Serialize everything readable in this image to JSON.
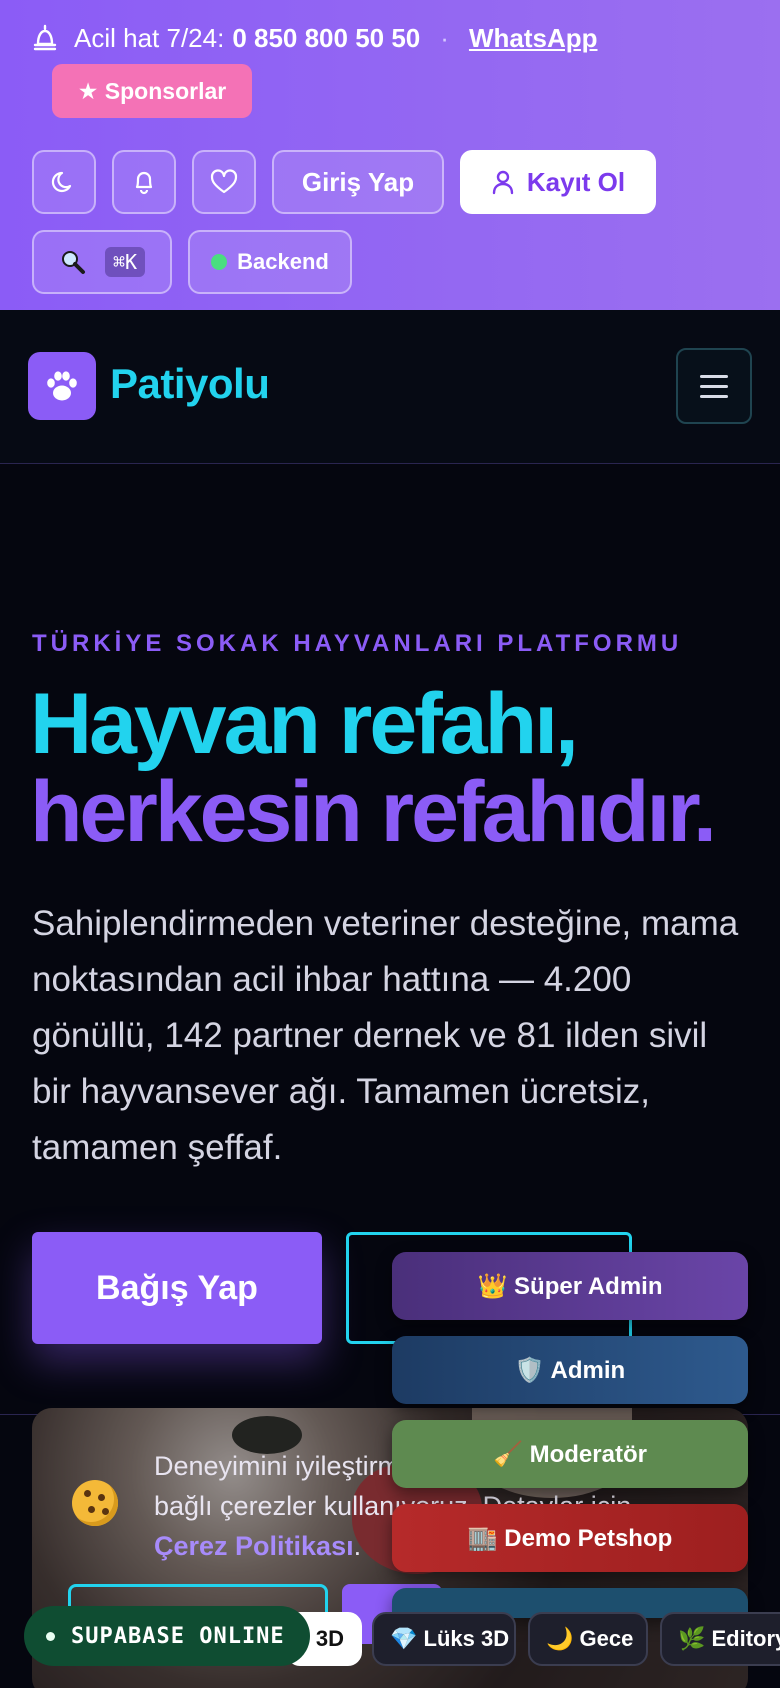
{
  "topbar": {
    "hotline_label": "Acil hat 7/24:",
    "hotline_number": "0 850 800 50 50",
    "separator": "·",
    "whatsapp_label": "WhatsApp",
    "sponsors_label": "★ Sponsorlar",
    "login_label": "Giriş Yap",
    "register_label": "Kayıt Ol",
    "search_shortcut": "⌘K",
    "backend_label": "Backend",
    "backend_status_color": "#4ade80",
    "icons": [
      "bell-hotline-icon",
      "moon-icon",
      "bell-icon",
      "heart-icon",
      "user-icon",
      "search-icon"
    ]
  },
  "nav": {
    "brand": "Patiyolu",
    "brand_color": "#22d3ee",
    "logo_icon": "paw-icon",
    "menu_icon": "hamburger-icon"
  },
  "hero": {
    "eyebrow": "TÜRKİYE SOKAK HAYVANLARI PLATFORMU",
    "headline_line1": "Hayvan refahı,",
    "headline_line2": "herkesin refahıdır.",
    "lead": "Sahiplendirmeden veteriner desteğine, mama noktasından acil ihbar hattına — 4.200 gönüllü, 142 partner dernek ve 81 ilden sivil bir hayvansever ağı. Tamamen ücretsiz, tamamen şeffaf.",
    "donate_label": "Bağış Yap",
    "accent_cyan": "#22d3ee",
    "accent_purple": "#8b5cf6"
  },
  "cookie": {
    "text_visible": "Deneyimini iyileştirm",
    "text_line2": "bağlı çerezler kullanıyoruz. Detaylar için",
    "policy_link": "Çerez Politikası",
    "policy_suffix": "."
  },
  "roles": {
    "super_admin": "👑 Süper Admin",
    "admin": "🛡️ Admin",
    "moderator": "🧹 Moderatör",
    "demo_petshop": "🏬 Demo Petshop"
  },
  "themes": {
    "light_fragment": "3D",
    "lux": "💎 Lüks 3D",
    "night": "🌙 Gece",
    "editorial": "🌿 Editory"
  },
  "status": {
    "label": "SUPABASE ONLINE",
    "color": "#0f4d32"
  }
}
